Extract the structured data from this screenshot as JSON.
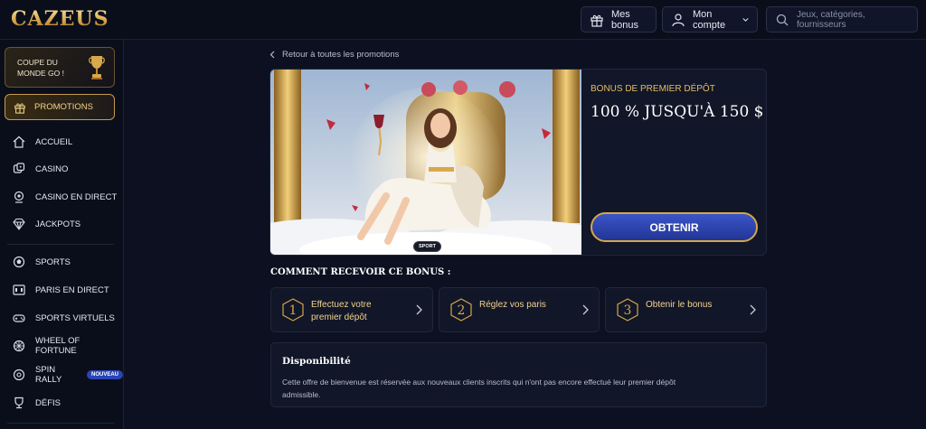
{
  "header": {
    "logo": "CAZEUS",
    "bonus_label": "Mes bonus",
    "account_label": "Mon compte",
    "search_placeholder": "Jeux, catégories, fournisseurs"
  },
  "sidebar": {
    "worldcup_line1": "COUPE DU",
    "worldcup_line2": "MONDE GO !",
    "promotions": "PROMOTIONS",
    "items": [
      {
        "label": "ACCUEIL",
        "icon": "home-icon"
      },
      {
        "label": "CASINO",
        "icon": "dice-icon"
      },
      {
        "label": "CASINO EN DIRECT",
        "icon": "live-casino-icon"
      },
      {
        "label": "JACKPOTS",
        "icon": "diamond-icon"
      },
      {
        "label": "SPORTS",
        "icon": "ball-icon"
      },
      {
        "label": "PARIS EN DIRECT",
        "icon": "live-score-icon"
      },
      {
        "label": "SPORTS VIRTUELS",
        "icon": "gamepad-icon"
      },
      {
        "label": "WHEEL OF FORTUNE",
        "icon": "wheel-icon"
      },
      {
        "label": "SPIN RALLY",
        "icon": "spin-icon",
        "badge": "NOUVEAU"
      },
      {
        "label": "DÉFIS",
        "icon": "trophy-icon"
      }
    ]
  },
  "main": {
    "back_label": "Retour à toutes les promotions",
    "promo_subtitle": "BONUS DE PREMIER DÉPÔT",
    "promo_title": "100 % JUSQU'À 150 $",
    "cta_label": "OBTENIR",
    "image_tag": "SPORT",
    "how_title": "COMMENT RECEVOIR CE BONUS :",
    "steps": [
      {
        "number": "1",
        "line1": "Effectuez votre",
        "line2": "premier dépôt"
      },
      {
        "number": "2",
        "line1": "Réglez vos paris",
        "line2": ""
      },
      {
        "number": "3",
        "line1": "Obtenir le bonus",
        "line2": ""
      }
    ],
    "availability_title": "Disponibilité",
    "availability_text": "Cette offre de bienvenue est réservée aux nouveaux clients inscrits qui n'ont pas encore effectué leur premier dépôt admissible."
  },
  "colors": {
    "background": "#0c1020",
    "gold": "#d4a64a",
    "cta_blue": "#2f47b8"
  }
}
